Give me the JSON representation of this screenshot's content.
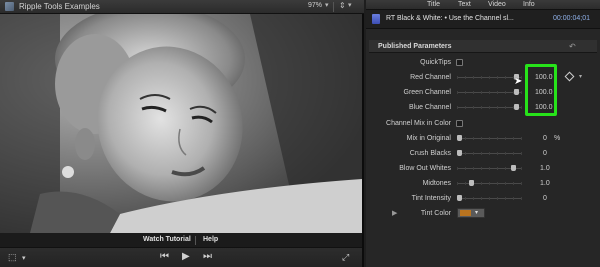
{
  "viewer": {
    "title": "Ripple Tools Examples",
    "zoom": "97%",
    "toolbar": {
      "watch": "Watch Tutorial",
      "help": "Help"
    }
  },
  "inspector": {
    "tabs": [
      "Title",
      "Text",
      "Video",
      "Info"
    ],
    "effect_name": "RT Black & White: • Use the Channel sl...",
    "timecode": "00:00:04;01",
    "section_title": "Published Parameters",
    "params": [
      {
        "label": "QuickTips",
        "kind": "checkbox",
        "checked": false
      },
      {
        "label": "Red Channel",
        "kind": "slider",
        "value": "100.0",
        "level": 0.97
      },
      {
        "label": "Green Channel",
        "kind": "slider",
        "value": "100.0",
        "level": 0.97
      },
      {
        "label": "Blue Channel",
        "kind": "slider",
        "value": "100.0",
        "level": 0.97
      },
      {
        "label": "Channel Mix in Color",
        "kind": "checkbox",
        "checked": false
      },
      {
        "label": "Mix in Original",
        "kind": "slider",
        "value": "0",
        "unit": "%",
        "level": 0.0
      },
      {
        "label": "Crush Blacks",
        "kind": "slider",
        "value": "0",
        "level": 0.0
      },
      {
        "label": "Blow Out Whites",
        "kind": "slider",
        "value": "1.0",
        "level": 0.92
      },
      {
        "label": "Midtones",
        "kind": "slider",
        "value": "1.0",
        "level": 0.2
      },
      {
        "label": "Tint Intensity",
        "kind": "slider",
        "value": "0",
        "level": 0.0
      },
      {
        "label": "Tint Color",
        "kind": "color",
        "color": "#b8731f"
      }
    ]
  },
  "colors": {
    "highlight": "#27e31a",
    "accent_time": "#8fb0e8"
  }
}
